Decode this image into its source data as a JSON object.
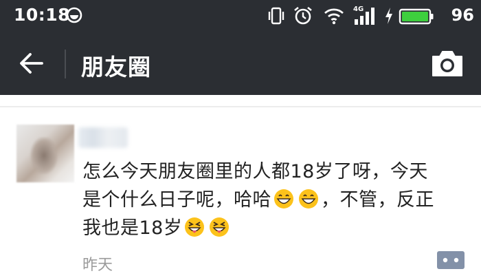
{
  "status_bar": {
    "time": "10:18",
    "battery": "96",
    "network": "4G",
    "icons": [
      "screenshot-icon",
      "vibrate-icon",
      "alarm-icon",
      "wifi-icon",
      "signal-icon",
      "charging-icon",
      "battery-icon"
    ]
  },
  "app_bar": {
    "title": "朋友圈",
    "back_icon": "back-arrow-icon",
    "camera_icon": "camera-icon"
  },
  "post": {
    "line1": "怎么今天朋友圈里的人都18岁了呀，今天",
    "line2_a": "是个什么日子呢，哈哈",
    "line2_b": "，不管，反正",
    "line3": "我也是18岁",
    "emojis": [
      "grinning-face",
      "grinning-face",
      "grinning-squint-tongue-face",
      "grinning-squint-tongue-face"
    ],
    "time": "昨天"
  },
  "colors": {
    "header_bg": "#2b2e33",
    "text": "#222222",
    "meta_text": "#9a9a9a",
    "comment_button": "#8391a8",
    "battery_green": "#3ecf3e"
  }
}
